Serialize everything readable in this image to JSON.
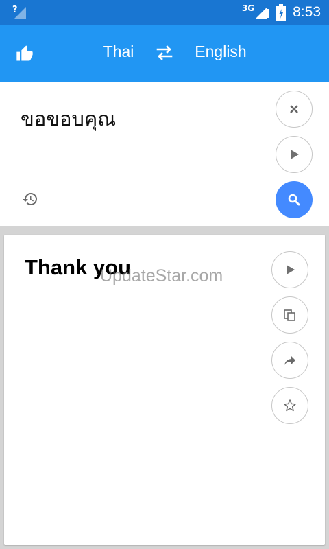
{
  "status_bar": {
    "network": "3G",
    "time": "8:53"
  },
  "toolbar": {
    "source_language": "Thai",
    "target_language": "English"
  },
  "input": {
    "text": "ขอขอบคุณ"
  },
  "output": {
    "text": "Thank you",
    "watermark": "UpdateStar.com"
  },
  "colors": {
    "status_bar": "#1976d2",
    "toolbar": "#2196f3",
    "search_button": "#448aff"
  },
  "icons": [
    "like-icon",
    "swap-icon",
    "close-icon",
    "play-icon",
    "search-icon",
    "history-icon",
    "copy-icon",
    "share-icon",
    "star-icon"
  ]
}
